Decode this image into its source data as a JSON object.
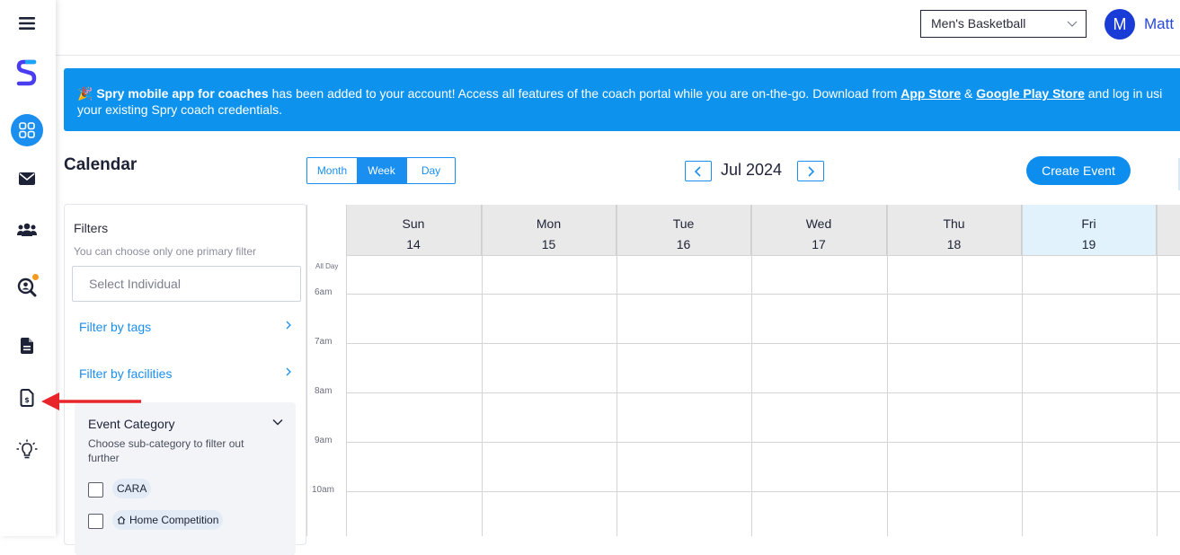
{
  "sidebar": {
    "items": [
      {
        "name": "menu-icon"
      },
      {
        "name": "spry-logo-icon"
      },
      {
        "name": "dashboard-grid-icon",
        "active": true
      },
      {
        "name": "envelope-icon"
      },
      {
        "name": "users-icon"
      },
      {
        "name": "scouting-search-icon",
        "badge": true
      },
      {
        "name": "document-icon"
      },
      {
        "name": "contract-document-icon"
      },
      {
        "name": "lightbulb-icon"
      }
    ]
  },
  "header": {
    "team_select": "Men's Basketball",
    "avatar_initial": "M",
    "user_name": "Matt"
  },
  "banner": {
    "emoji": "🎉",
    "bold_lead": "Spry mobile app for coaches",
    "text1": " has been added to your account! Access all features of the coach portal while you are on-the-go. Download from ",
    "link_app_store": "App Store",
    "amp": " & ",
    "link_play_store": "Google Play Store",
    "text2": " and log in usi",
    "line2": "your existing Spry coach credentials."
  },
  "calendar": {
    "title": "Calendar",
    "views": [
      "Month",
      "Week",
      "Day"
    ],
    "active_view": "Week",
    "month_label": "Jul 2024",
    "create_event": "Create Event",
    "days": [
      {
        "name": "Sun",
        "num": "14"
      },
      {
        "name": "Mon",
        "num": "15"
      },
      {
        "name": "Tue",
        "num": "16"
      },
      {
        "name": "Wed",
        "num": "17"
      },
      {
        "name": "Thu",
        "num": "18"
      },
      {
        "name": "Fri",
        "num": "19",
        "today": true
      }
    ],
    "time_labels": [
      "All Day",
      "6am",
      "7am",
      "8am",
      "9am",
      "10am"
    ]
  },
  "filters": {
    "title": "Filters",
    "hint": "You can choose only one primary filter",
    "select_placeholder": "Select Individual",
    "filter_tags": "Filter by tags",
    "filter_facilities": "Filter by facilities",
    "event_category": {
      "title": "Event Category",
      "subtitle": "Choose sub-category to filter out further",
      "options": [
        "CARA",
        "Home Competition"
      ]
    }
  },
  "colors": {
    "accent": "#1a8ff0",
    "banner": "#0d93ee",
    "today": "#e1f2fc",
    "pointer_arrow": "#e8252a"
  }
}
